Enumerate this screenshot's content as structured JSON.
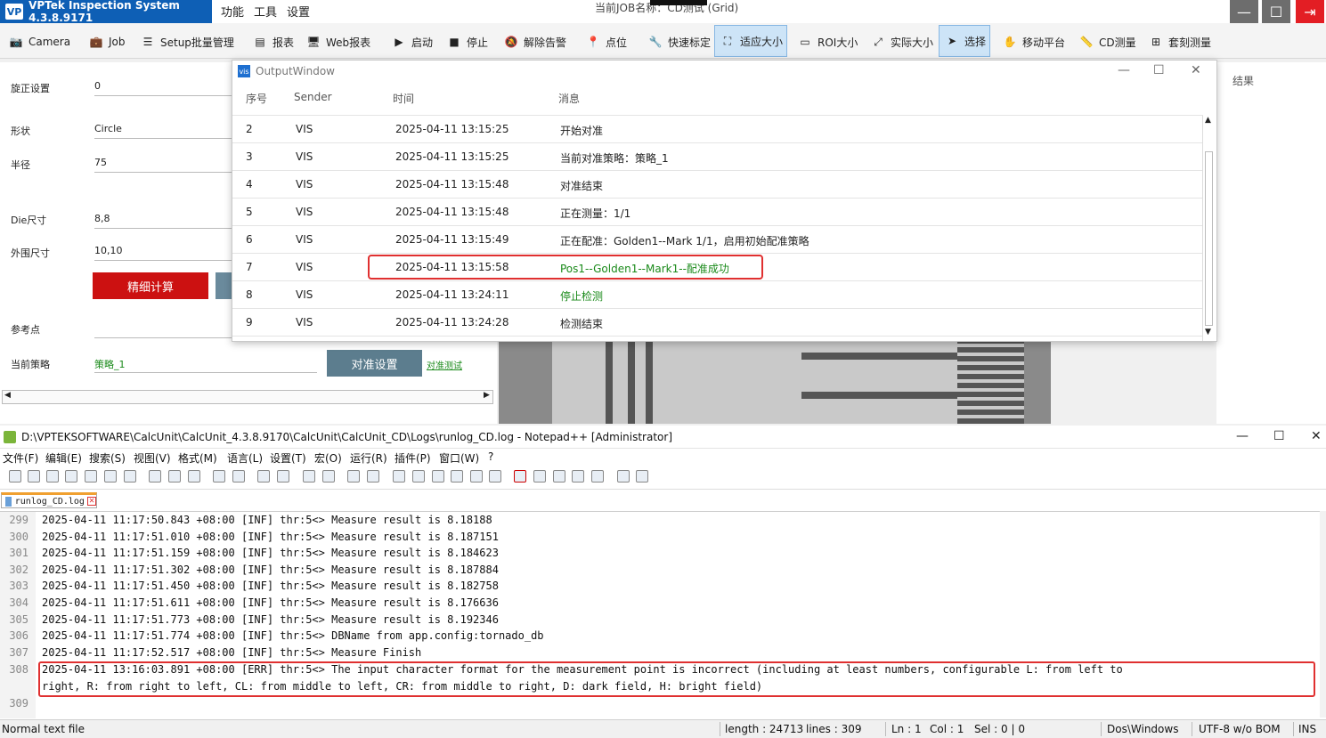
{
  "app": {
    "title": "VPTek Inspection System 4.3.8.9171",
    "logo_text": "VP",
    "menu": [
      "功能",
      "工具",
      "设置"
    ],
    "job_title": "当前JOB名称：CD测试 (Grid)",
    "accent": "#0e5fb5",
    "close_color": "#e31e24"
  },
  "toolbar": {
    "items": [
      "Camera",
      "Job",
      "Setup批量管理",
      "报表",
      "Web报表",
      "启动",
      "停止",
      "解除告警",
      "点位",
      "快速标定",
      "适应大小",
      "ROI大小",
      "实际大小",
      "选择",
      "移动平台",
      "CD测量",
      "套刻测量"
    ]
  },
  "left_panel": {
    "labels": [
      "旋正设置",
      "形状",
      "半径",
      "Die尺寸",
      "外围尺寸",
      "参考点",
      "当前策略"
    ],
    "values": [
      "0",
      "Circle",
      "75",
      "8,8",
      "10,10",
      "",
      "策略_1"
    ],
    "calc_button": "精细计算",
    "align_button": "对准设置",
    "align_test_link": "对准测试"
  },
  "result_panel": {
    "header": "结果"
  },
  "output_window": {
    "title": "OutputWindow",
    "columns": [
      "序号",
      "Sender",
      "时间",
      "消息"
    ],
    "rows": [
      {
        "idx": "2",
        "sender": "VIS",
        "time": "2025-04-11 13:15:25",
        "msg": "开始对准",
        "green": false
      },
      {
        "idx": "3",
        "sender": "VIS",
        "time": "2025-04-11 13:15:25",
        "msg": "当前对准策略：策略_1",
        "green": false
      },
      {
        "idx": "4",
        "sender": "VIS",
        "time": "2025-04-11 13:15:48",
        "msg": "对准结束",
        "green": false
      },
      {
        "idx": "5",
        "sender": "VIS",
        "time": "2025-04-11 13:15:48",
        "msg": "正在测量：1/1",
        "green": false
      },
      {
        "idx": "6",
        "sender": "VIS",
        "time": "2025-04-11 13:15:49",
        "msg": "正在配准：Golden1--Mark 1/1，启用初始配准策略",
        "green": false
      },
      {
        "idx": "7",
        "sender": "VIS",
        "time": "2025-04-11 13:15:58",
        "msg": "Pos1--Golden1--Mark1--配准成功",
        "green": true
      },
      {
        "idx": "8",
        "sender": "VIS",
        "time": "2025-04-11 13:24:11",
        "msg": "停止检测",
        "green": true
      },
      {
        "idx": "9",
        "sender": "VIS",
        "time": "2025-04-11 13:24:28",
        "msg": "检测结束",
        "green": false
      }
    ]
  },
  "notepad": {
    "title": "D:\\VPTEKSOFTWARE\\CalcUnit\\CalcUnit_4.3.8.9170\\CalcUnit\\CalcUnit_CD\\Logs\\runlog_CD.log - Notepad++ [Administrator]",
    "menu": [
      "文件(F)",
      "编辑(E)",
      "搜索(S)",
      "视图(V)",
      "格式(M)",
      "语言(L)",
      "设置(T)",
      "宏(O)",
      "运行(R)",
      "插件(P)",
      "窗口(W)",
      "?"
    ],
    "tab": "runlog_CD.log",
    "lines": [
      {
        "n": "299",
        "text": "2025-04-11 11:17:50.843 +08:00 [INF] thr:5<> Measure result is 8.18188"
      },
      {
        "n": "300",
        "text": "2025-04-11 11:17:51.010 +08:00 [INF] thr:5<> Measure result is 8.187151"
      },
      {
        "n": "301",
        "text": "2025-04-11 11:17:51.159 +08:00 [INF] thr:5<> Measure result is 8.184623"
      },
      {
        "n": "302",
        "text": "2025-04-11 11:17:51.302 +08:00 [INF] thr:5<> Measure result is 8.187884"
      },
      {
        "n": "303",
        "text": "2025-04-11 11:17:51.450 +08:00 [INF] thr:5<> Measure result is 8.182758"
      },
      {
        "n": "304",
        "text": "2025-04-11 11:17:51.611 +08:00 [INF] thr:5<> Measure result is 8.176636"
      },
      {
        "n": "305",
        "text": "2025-04-11 11:17:51.773 +08:00 [INF] thr:5<> Measure result is 8.192346"
      },
      {
        "n": "306",
        "text": "2025-04-11 11:17:51.774 +08:00 [INF] thr:5<> DBName from app.config:tornado_db"
      },
      {
        "n": "307",
        "text": "2025-04-11 11:17:52.517 +08:00 [INF] thr:5<> Measure Finish"
      },
      {
        "n": "308",
        "text": "2025-04-11 13:16:03.891 +08:00 [ERR] thr:5<> The input character format for the measurement point is incorrect (including at least numbers, configurable L: from left to"
      },
      {
        "n": "",
        "text": "right, R: from right to left, CL: from middle to left, CR: from middle to right, D: dark field, H: bright field)"
      },
      {
        "n": "309",
        "text": ""
      }
    ],
    "status": {
      "type": "Normal text file",
      "length": "length : 24713",
      "lines": "lines : 309",
      "ln": "Ln : 1",
      "col": "Col : 1",
      "sel": "Sel : 0 | 0",
      "eol": "Dos\\Windows",
      "encoding": "UTF-8 w/o BOM",
      "mode": "INS"
    }
  }
}
